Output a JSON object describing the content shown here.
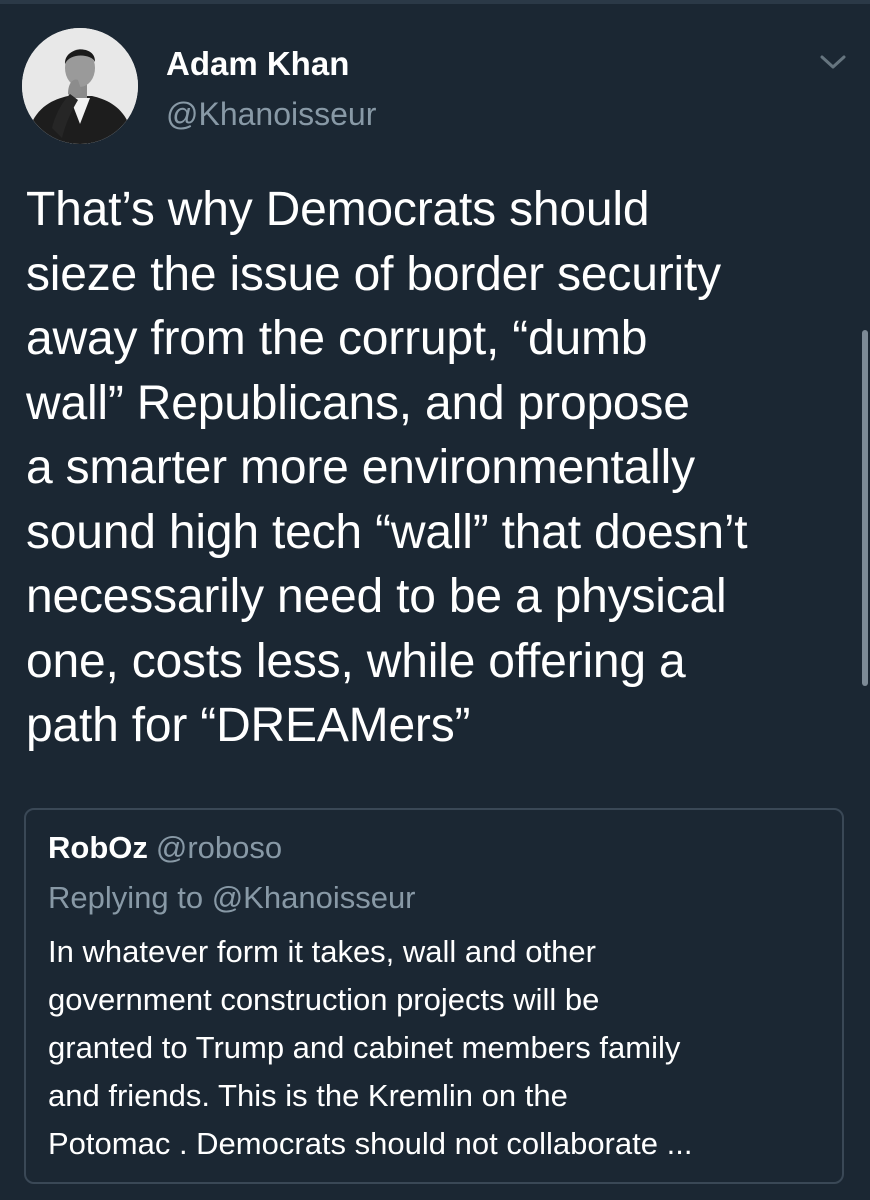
{
  "tweet": {
    "author_name": "Adam Khan",
    "author_handle": "@Khanoisseur",
    "text_lines": [
      "That’s why Democrats should",
      "sieze the issue of border security",
      "away from the corrupt, “dumb",
      "wall” Republicans, and propose",
      "a smarter more environmentally",
      "sound high tech “wall” that doesn’t",
      "necessarily need to be a physical",
      "one, costs less, while offering a",
      "path for “DREAMers”"
    ]
  },
  "quoted_tweet": {
    "author_name": "RobOz",
    "author_handle": "@roboso",
    "reply_context": "Replying to @Khanoisseur",
    "text_lines": [
      "In whatever form it takes, wall and other",
      "government construction projects will be",
      "granted to Trump and cabinet members family",
      "and friends. This is the Kremlin on the",
      "Potomac . Democrats should not collaborate ..."
    ]
  },
  "icons": {
    "avatar": "avatar-photo",
    "menu": "chevron-down-icon"
  },
  "colors": {
    "background": "#1b2733",
    "primary_text": "#ffffff",
    "secondary_text": "#8899a6",
    "card_border": "#3a4856"
  }
}
